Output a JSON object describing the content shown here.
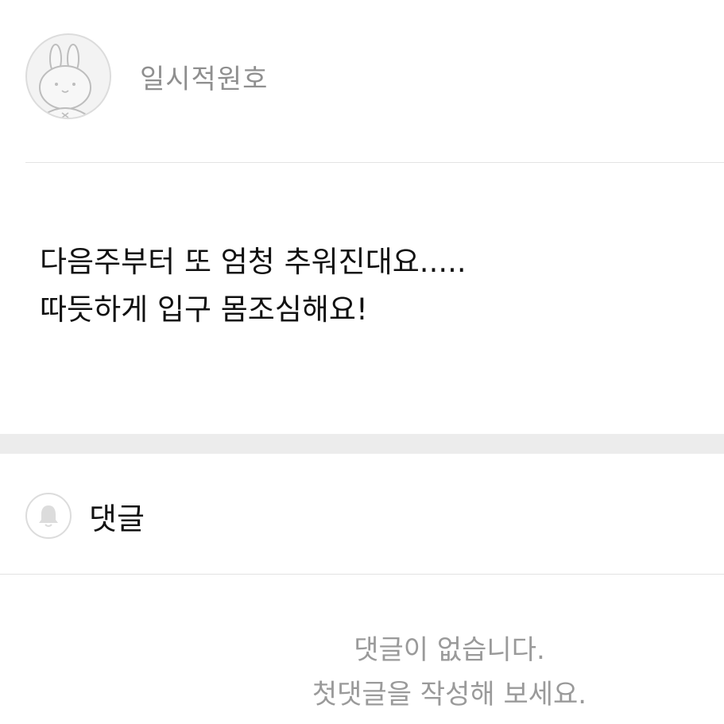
{
  "post": {
    "author_name": "일시적원호",
    "avatar_icon": "bunny-avatar-icon",
    "lines": [
      "다음주부터 또 엄청 추워진대요.....",
      "따듯하게 입구 몸조심해요!"
    ]
  },
  "comments": {
    "icon": "bell-icon",
    "title": "댓글",
    "empty_line1": "댓글이 없습니다.",
    "empty_line2": "첫댓글을 작성해 보세요."
  },
  "colors": {
    "divider": "#e3e3e3",
    "band": "#ececec",
    "muted_text": "#9a9a9a",
    "author_text": "#8f8f8f"
  }
}
